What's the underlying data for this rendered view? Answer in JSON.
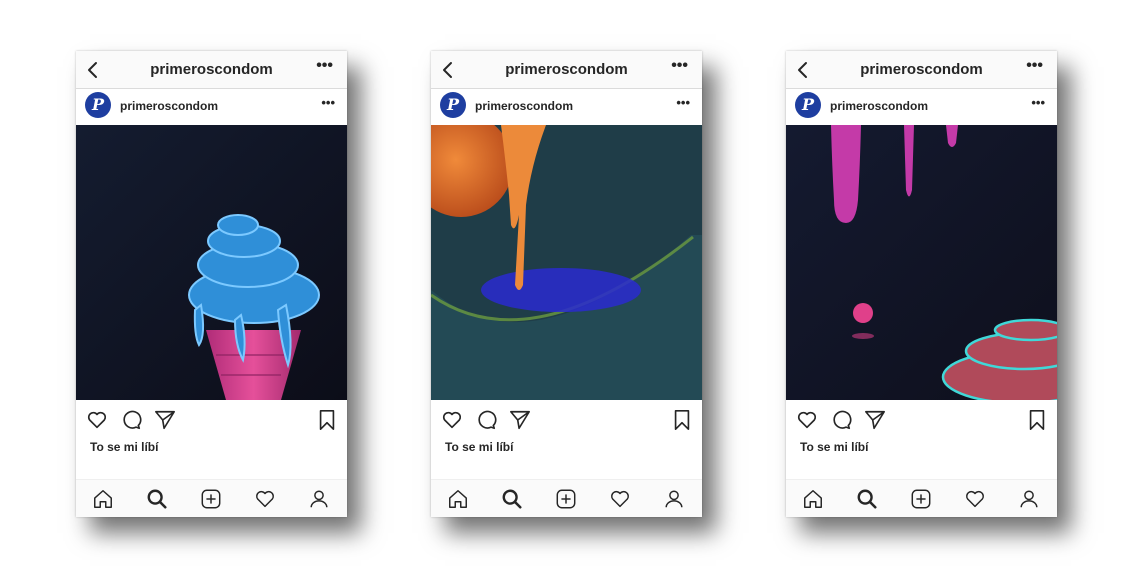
{
  "screens": [
    {
      "header": {
        "title": "primeroscondom",
        "more_label": "•••"
      },
      "post": {
        "avatar_letter": "P",
        "username": "primeroscondom",
        "more_label": "•••",
        "image_icon": "ice-cream-cone-illustration"
      },
      "likes_text": "To se mi líbí"
    },
    {
      "header": {
        "title": "primeroscondom",
        "more_label": "•••"
      },
      "post": {
        "avatar_letter": "P",
        "username": "primeroscondom",
        "more_label": "•••",
        "image_icon": "melting-scoop-illustration"
      },
      "likes_text": "To se mi líbí"
    },
    {
      "header": {
        "title": "primeroscondom",
        "more_label": "•••"
      },
      "post": {
        "avatar_letter": "P",
        "username": "primeroscondom",
        "more_label": "•••",
        "image_icon": "dripping-cream-illustration"
      },
      "likes_text": "To se mi líbí"
    }
  ],
  "icons": {
    "actions": [
      "heart-icon",
      "comment-icon",
      "share-icon",
      "bookmark-icon"
    ],
    "tabs": [
      "home-icon",
      "search-icon",
      "add-post-icon",
      "activity-heart-icon",
      "profile-icon"
    ]
  },
  "colors": {
    "avatar": "#1e3ea0",
    "bar_bg": "#fafafa",
    "text": "#262626"
  }
}
